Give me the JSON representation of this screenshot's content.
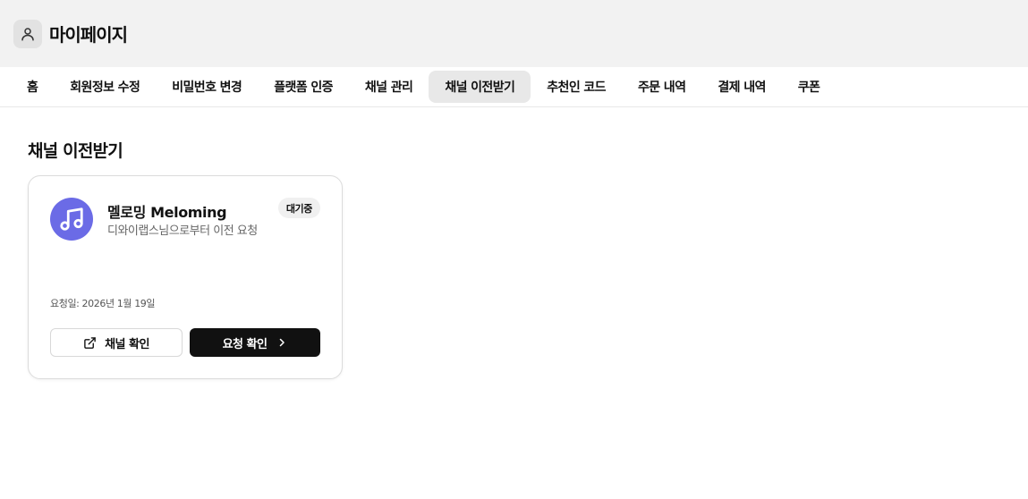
{
  "header": {
    "title": "마이페이지",
    "avatar_icon": "user-icon"
  },
  "tabs": [
    {
      "label": "홈",
      "active": false
    },
    {
      "label": "회원정보 수정",
      "active": false
    },
    {
      "label": "비밀번호 변경",
      "active": false
    },
    {
      "label": "플랫폼 인증",
      "active": false
    },
    {
      "label": "채널 관리",
      "active": false
    },
    {
      "label": "채널 이전받기",
      "active": true
    },
    {
      "label": "추천인 코드",
      "active": false
    },
    {
      "label": "주문 내역",
      "active": false
    },
    {
      "label": "결제 내역",
      "active": false
    },
    {
      "label": "쿠폰",
      "active": false
    }
  ],
  "main": {
    "section_title": "채널 이전받기",
    "card": {
      "channel_icon": "music-note-icon",
      "channel_icon_color": "#6b6be6",
      "channel_name": "멜로밍 Meloming",
      "request_desc": "디와이랩스님으로부터 이전 요청",
      "status": "대기중",
      "request_date": "요청일: 2026년 1월 19일",
      "view_channel_label": "채널 확인",
      "view_channel_icon": "external-link-icon",
      "view_request_label": "요청 확인",
      "view_request_icon": "chevron-right-icon"
    }
  }
}
